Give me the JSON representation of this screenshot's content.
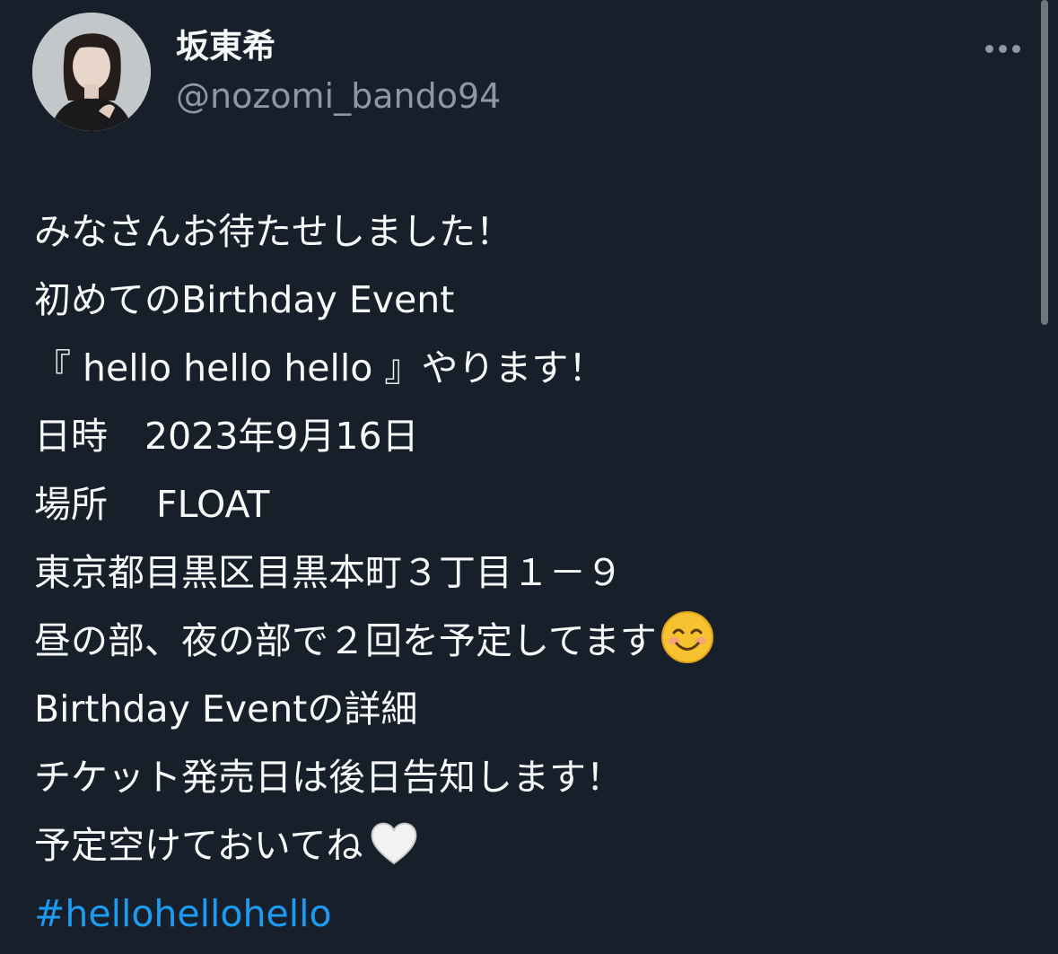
{
  "author": {
    "display_name": "坂東希",
    "handle": "@nozomi_bando94"
  },
  "menu": {
    "more_icon": "more-horizontal-icon"
  },
  "tweet": {
    "lines": [
      "みなさんお待たせしました！",
      "初めてのBirthday Event",
      "『 hello hello hello 』やります！",
      "日時　2023年9月16日",
      "場所　 FLOAT",
      "東京都目黒区目黒本町３丁目１－９",
      "昼の部、夜の部で２回を予定してます",
      "Birthday Eventの詳細",
      "チケット発売日は後日告知します！",
      "予定空けておいてね"
    ],
    "hashtag": "#hellohellohello",
    "emojis": [
      "smiling-face-emoji",
      "white-heart-emoji"
    ]
  },
  "colors": {
    "background": "#161f2a",
    "text": "#f7f9f9",
    "secondary_text": "#8b98a5",
    "link": "#1d9bf0"
  }
}
